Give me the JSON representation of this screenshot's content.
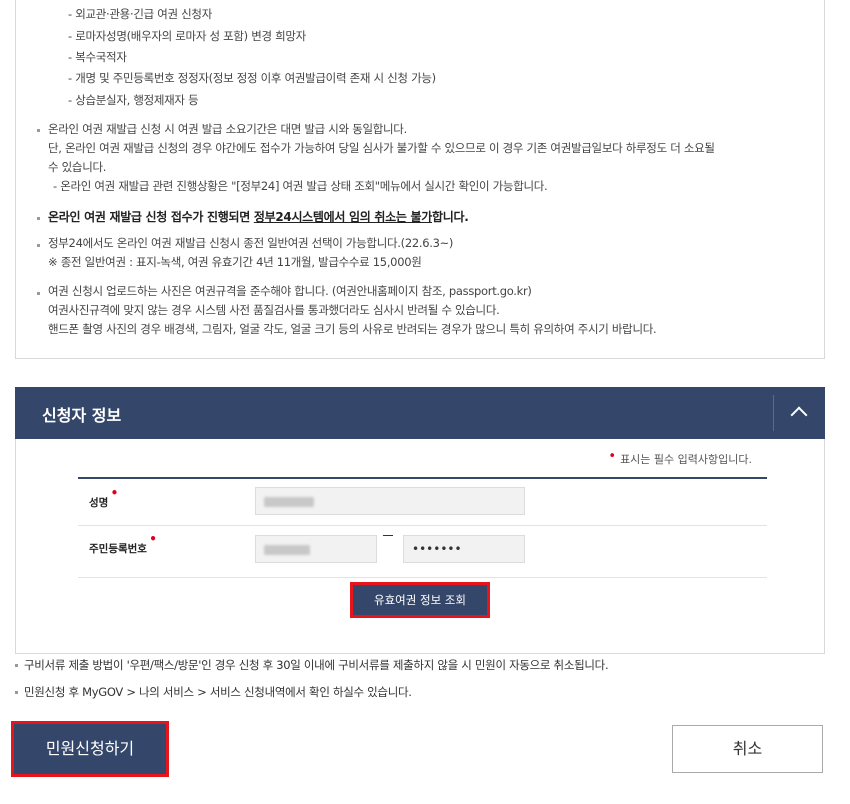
{
  "info": {
    "sub_items": [
      "- 외교관·관용·긴급 여권 신청자",
      "- 로마자성명(배우자의 로마자 성 포함) 변경 희망자",
      "- 복수국적자",
      "- 개명 및 주민등록번호 정정자(정보 정정 이후 여권발급이력 존재 시 신청 가능)",
      "- 상습분실자, 행정제재자 등"
    ],
    "para1": [
      "온라인 여권 재발급 신청 시 여권 발급 소요기간은 대면 발급 시와 동일합니다.",
      "단, 온라인 여권 재발급 신청의 경우 야간에도 접수가 가능하여 당일 심사가 불가할 수 있으므로 이 경우 기존 여권발급일보다 하루정도 더 소요될",
      "수 있습니다.",
      "- 온라인 여권 재발급 관련 진행상황은 \"[정부24] 여권 발급 상태 조회\"메뉴에서 실시간 확인이 가능합니다."
    ],
    "para2_part1": "온라인 여권 재발급 신청 접수가 진행되면 ",
    "para2_part2": "정부24시스템에서 임의 취소는 불가",
    "para2_part3": "합니다.",
    "para3": [
      "정부24에서도 온라인 여권 재발급 신청시 종전 일반여권 선택이 가능합니다.(22.6.3~)",
      "※ 종전 일반여권 : 표지-녹색, 여권 유효기간 4년 11개월, 발급수수료 15,000원"
    ],
    "para4": [
      "여권 신청시 업로드하는 사진은 여권규격을 준수해야 합니다. (여권안내홈페이지 참조, passport.go.kr)",
      "여권사진규격에 맞지 않는 경우 시스템 사전 품질검사를 통과했더라도 심사시 반려될 수 있습니다.",
      "핸드폰 촬영 사진의 경우 배경색, 그림자, 얼굴 각도, 얼굴 크기 등의 사유로 반려되는 경우가 많으니 특히 유의하여 주시기 바랍니다."
    ]
  },
  "applicant": {
    "section_title": "신청자 정보",
    "required_dot": "•",
    "required_note": "표시는 필수 입력사항입니다.",
    "name_label": "성명",
    "rrn_label": "주민등록번호",
    "rrn_back_value": "•••••••",
    "lookup_button": "유효여권 정보 조회"
  },
  "notes": [
    "구비서류 제출 방법이 '우편/팩스/방문'인 경우 신청 후 30일 이내에 구비서류를 제출하지 않을 시 민원이 자동으로 취소됩니다.",
    "민원신청 후 MyGOV > 나의 서비스 > 서비스 신청내역에서 확인 하실수 있습니다."
  ],
  "actions": {
    "submit_label": "민원신청하기",
    "cancel_label": "취소"
  },
  "colors": {
    "primary": "#34476b",
    "highlight": "#e8141c",
    "required": "#e0001b"
  }
}
